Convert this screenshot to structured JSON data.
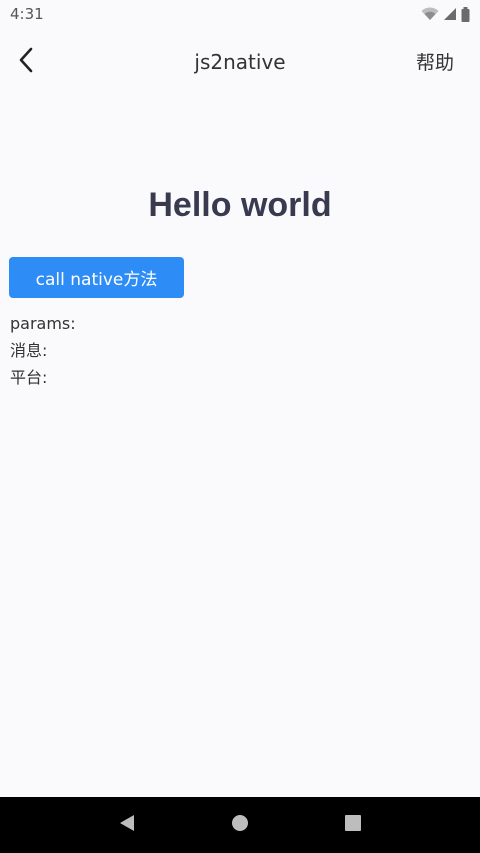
{
  "status_bar": {
    "time": "4:31",
    "icons": [
      "wifi-icon",
      "signal-icon",
      "battery-icon"
    ]
  },
  "nav": {
    "back_icon": "chevron-left-icon",
    "title": "js2native",
    "help_label": "帮助"
  },
  "main": {
    "heading": "Hello world",
    "call_button_label": "call native方法",
    "lines": {
      "params": "params:",
      "message": "消息:",
      "platform": "平台:"
    }
  },
  "system_nav": {
    "buttons": [
      "back-triangle-icon",
      "home-circle-icon",
      "recents-square-icon"
    ]
  },
  "colors": {
    "accent": "#2e8cf6",
    "heading": "#393a4f",
    "background": "#fafafd",
    "system_nav_bg": "#000000"
  }
}
